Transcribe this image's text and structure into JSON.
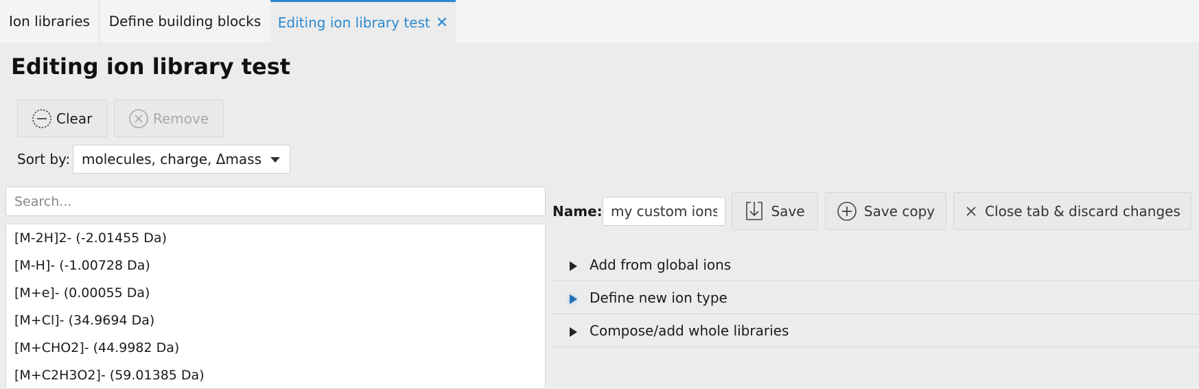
{
  "tabs": [
    {
      "label": "Ion libraries"
    },
    {
      "label": "Define building blocks"
    },
    {
      "label": "Editing ion library test",
      "active": true
    }
  ],
  "page_title": "Editing ion library test",
  "toolbar": {
    "clear_label": "Clear",
    "remove_label": "Remove"
  },
  "sort": {
    "label": "Sort by:",
    "selected": "molecules, charge, Δmass"
  },
  "search": {
    "placeholder": "Search..."
  },
  "ion_list": [
    "[M-2H]2- (-2.01455 Da)",
    "[M-H]- (-1.00728 Da)",
    "[M+e]- (0.00055 Da)",
    "[M+Cl]- (34.9694 Da)",
    "[M+CHO2]- (44.9982 Da)",
    "[M+C2H3O2]- (59.01385 Da)"
  ],
  "editor": {
    "name_label": "Name:",
    "name_value": "my custom ions",
    "save_label": "Save",
    "save_copy_label": "Save copy",
    "close_label": "Close tab & discard changes"
  },
  "sections": [
    {
      "label": "Add from global ions"
    },
    {
      "label": "Define new ion type"
    },
    {
      "label": "Compose/add whole libraries"
    }
  ],
  "colors": {
    "accent": "#2a8ad0",
    "disabled_text": "#a9a9a9"
  }
}
